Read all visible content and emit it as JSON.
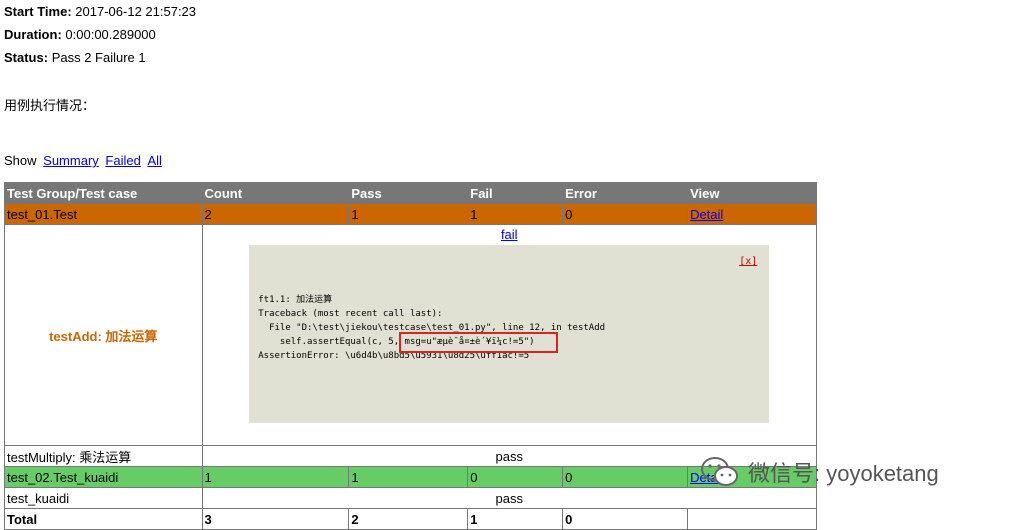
{
  "attributes": [
    {
      "label": "Start Time:",
      "value": "2017-06-12 21:57:23"
    },
    {
      "label": "Duration:",
      "value": "0:00:00.289000"
    },
    {
      "label": "Status:",
      "value": "Pass 2 Failure 1"
    }
  ],
  "description": "用例执行情况：",
  "filter": {
    "show_label": "Show",
    "summary": "Summary",
    "failed": "Failed",
    "all": "All"
  },
  "table": {
    "headers": [
      "Test Group/Test case",
      "Count",
      "Pass",
      "Fail",
      "Error",
      "View"
    ],
    "group1": {
      "name": "test_01.Test",
      "count": "2",
      "pass": "1",
      "fail": "1",
      "error": "0",
      "view": "Detail"
    },
    "case_add": {
      "name": "testAdd: 加法运算",
      "link": "fail",
      "close": "[x]",
      "output": "ft1.1: 加法运算\nTraceback (most recent call last):\n  File \"D:\\test\\jiekou\\testcase\\test_01.py\", line 12, in testAdd\n    self.assertEqual(c, 5, msg=u\"æµè¯å¤±è´¥ï¼c!=5\")\nAssertionError: \\u6d4b\\u8bd5\\u5931\\u8d25\\uff1ac!=5"
    },
    "case_multiply": {
      "name": "testMultiply: 乘法运算",
      "status": "pass"
    },
    "group2": {
      "name": "test_02.Test_kuaidi",
      "count": "1",
      "pass": "1",
      "fail": "0",
      "error": "0",
      "view": "Detail"
    },
    "case_kuaidi": {
      "name": "test_kuaidi",
      "status": "pass"
    },
    "total": {
      "label": "Total",
      "count": "3",
      "pass": "2",
      "fail": "1",
      "error": "0"
    }
  },
  "watermark": {
    "text": "微信号: yoyoketang",
    "icon": "wechat-icon"
  },
  "colors": {
    "header": "#777777",
    "fail_group": "#cc6600",
    "pass_group": "#66cc66",
    "popup": "#e0e0d3",
    "highlight": "#dd2222"
  }
}
